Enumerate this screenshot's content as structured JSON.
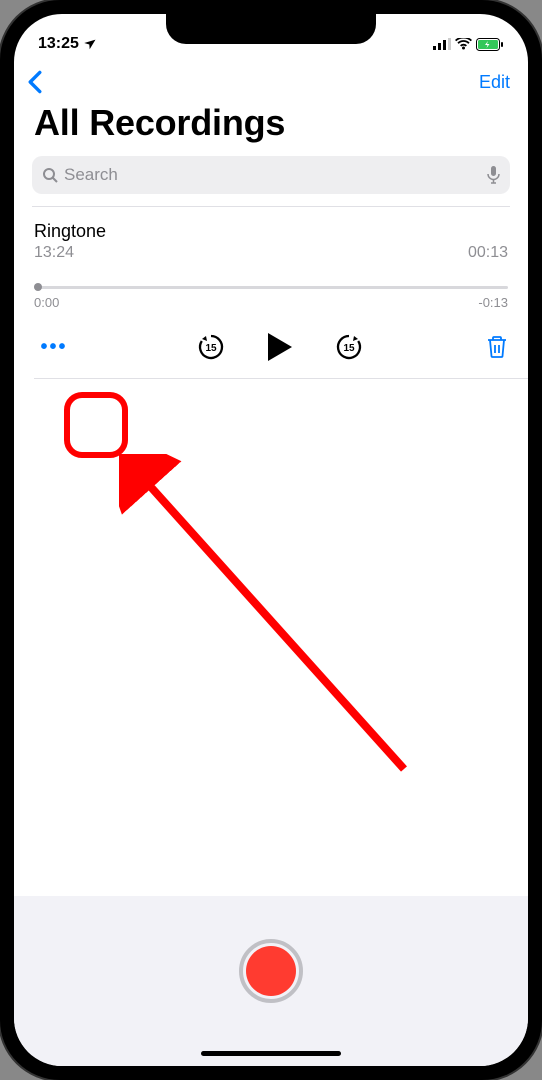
{
  "status": {
    "time": "13:25",
    "location_icon": "location-arrow"
  },
  "nav": {
    "back_icon": "chevron-left",
    "edit_label": "Edit"
  },
  "page": {
    "title": "All Recordings"
  },
  "search": {
    "placeholder": "Search"
  },
  "recording": {
    "title": "Ringtone",
    "time": "13:24",
    "duration": "00:13",
    "elapsed": "0:00",
    "remaining": "-0:13",
    "skip_back_seconds": "15",
    "skip_forward_seconds": "15"
  },
  "icons": {
    "more": "•••"
  }
}
